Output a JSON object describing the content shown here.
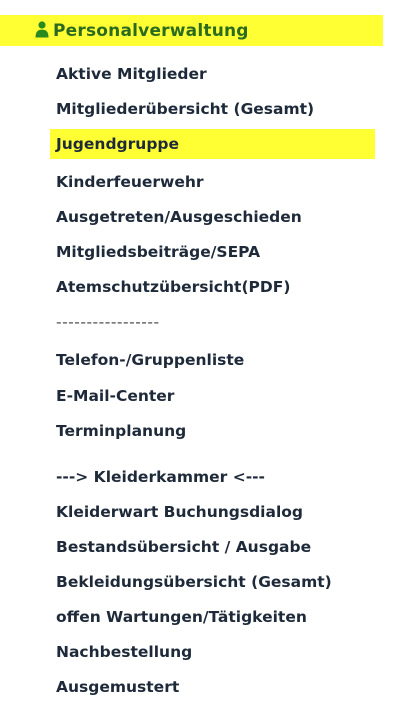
{
  "header": {
    "label": "Personalverwaltung",
    "icon": "person-icon",
    "highlight_color": "#ffff33",
    "icon_color": "#2b8a1f"
  },
  "menu": {
    "items": [
      {
        "label": "Aktive Mitglieder"
      },
      {
        "label": "Mitgliederübersicht (Gesamt)"
      },
      {
        "label": "Jugendgruppe",
        "active": true
      },
      {
        "label": "Kinderfeuerwehr"
      },
      {
        "label": "Ausgetreten/Ausgeschieden"
      },
      {
        "label": "Mitgliedsbeiträge/SEPA"
      },
      {
        "label": "Atemschutzübersicht(PDF)"
      },
      {
        "label": "-----------------"
      },
      {
        "label": "Telefon-/Gruppenliste"
      },
      {
        "label": "E-Mail-Center"
      },
      {
        "label": "Terminplanung"
      },
      {
        "label": "---> Kleiderkammer <---"
      },
      {
        "label": "Kleiderwart Buchungsdialog"
      },
      {
        "label": "Bestandsübersicht / Ausgabe"
      },
      {
        "label": "Bekleidungsübersicht (Gesamt)"
      },
      {
        "label": "offen Wartungen/Tätigkeiten"
      },
      {
        "label": "Nachbestellung"
      },
      {
        "label": "Ausgemustert"
      }
    ]
  }
}
